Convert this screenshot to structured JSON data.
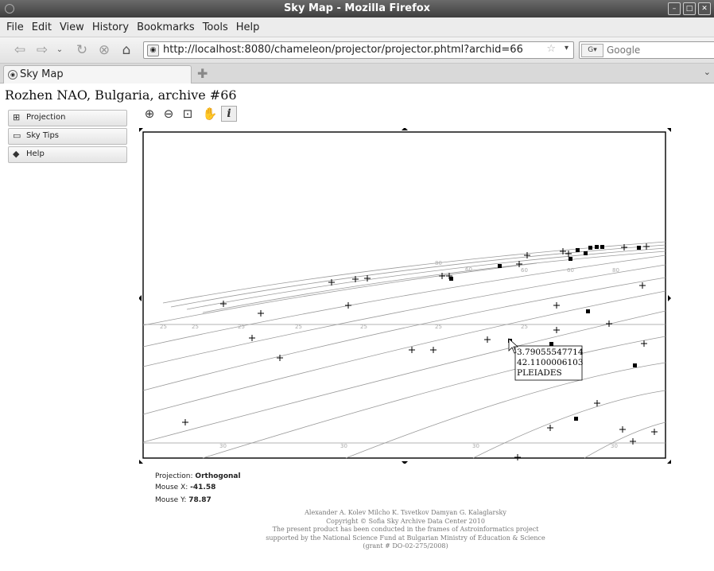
{
  "window": {
    "title": "Sky Map - Mozilla Firefox"
  },
  "menu": [
    "File",
    "Edit",
    "View",
    "History",
    "Bookmarks",
    "Tools",
    "Help"
  ],
  "nav": {
    "url": "http://localhost:8080/chameleon/projector/projector.phtml?archid=66",
    "search_placeholder": "Google"
  },
  "tabs": [
    {
      "label": "Sky Map"
    }
  ],
  "page": {
    "heading": "Rozhen NAO, Bulgaria, archive #66"
  },
  "sidebar": {
    "items": [
      {
        "label": "Projection",
        "icon": "globe-icon"
      },
      {
        "label": "Sky Tips",
        "icon": "speech-bubble-icon"
      },
      {
        "label": "Help",
        "icon": "help-book-icon"
      }
    ]
  },
  "toolbar": {
    "info_label": "i"
  },
  "skymap": {
    "tooltip": {
      "ra": "3.79055547714",
      "dec": "42.1100006103",
      "name": "PLEIADES"
    },
    "grid_labels": [
      "80",
      "60",
      "60",
      "60",
      "80",
      "25",
      "25",
      "25",
      "25",
      "25",
      "25",
      "25",
      "30",
      "30",
      "30",
      "30"
    ]
  },
  "readout": {
    "projection_label": "Projection:",
    "projection_value": "Orthogonal",
    "mouse_x_label": "Mouse X:",
    "mouse_x_value": "-41.58",
    "mouse_y_label": "Mouse Y:",
    "mouse_y_value": "78.87"
  },
  "footer": {
    "line1": "Alexander A. Kolev Milcho K. Tsvetkov Damyan G. Kalaglarsky",
    "line2": "Copyright © Sofia Sky Archive Data Center 2010",
    "line3": "The present product has been conducted in the frames of Astroinformatics project",
    "line4": "supported by the National Science Fund at Bulgarian Ministry of Education & Science",
    "line5": "(grant # DO-02-275/2008)"
  }
}
